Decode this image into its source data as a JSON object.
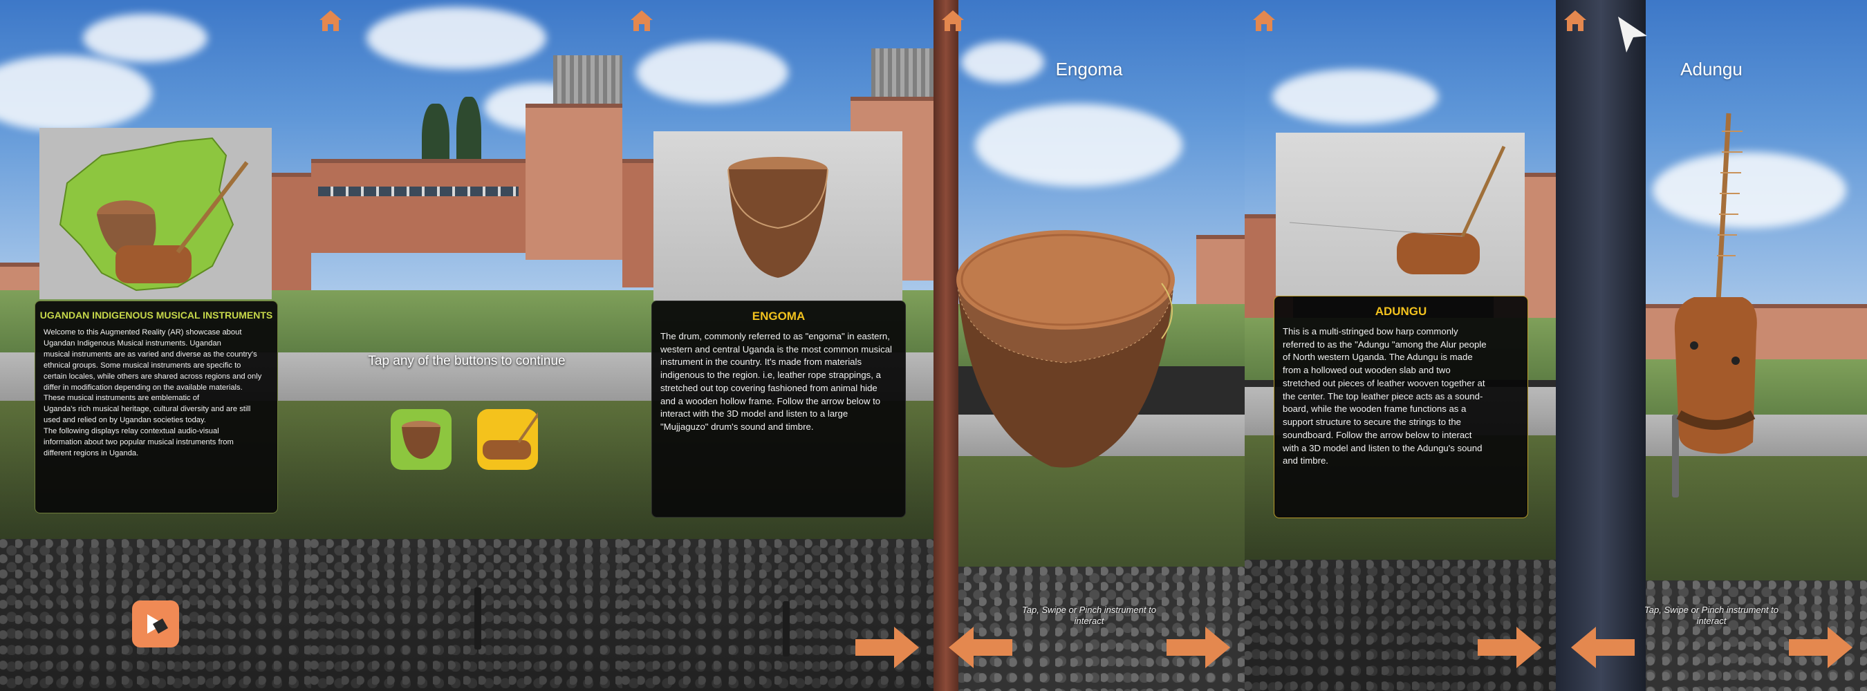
{
  "colors": {
    "accent_orange": "#e4884f",
    "lime": "#8dc63f",
    "gold": "#f4c21c",
    "title_green": "#c7d84a",
    "title_gold": "#f2c21e"
  },
  "screens": [
    {
      "id": "intro",
      "card": {
        "title": "UGANDAN INDIGENOUS  MUSICAL INSTRUMENTS",
        "body": "Welcome to this Augmented Reality (AR) showcase about\nUgandan Indigenous Musical instruments. Ugandan\nmusical instruments are as varied and diverse as the country's\nethnical groups. Some musical instruments are specific to\ncertain locales, while others are shared across regions and only\ndiffer in modification depending on the available materials.\nThese musical instruments are emblematic of\nUganda's rich musical heritage, cultural diversity and are still\nused and relied on by Ugandan societies today.\nThe following displays relay contextual audio-visual\ninformation about two popular musical instruments from\n different regions in Uganda."
      },
      "icons": [
        "uganda-map-icon",
        "play-next-icon"
      ]
    },
    {
      "id": "select",
      "prompt": "Tap any of the buttons to continue",
      "buttons": [
        {
          "name": "engoma-select-button",
          "color": "#8dc63f"
        },
        {
          "name": "adungu-select-button",
          "color": "#f4c21c"
        }
      ]
    },
    {
      "id": "engoma-info",
      "card": {
        "title": "ENGOMA",
        "body": "The drum, commonly referred to as \"engoma\" in eastern,\nwestern and central Uganda is the most common musical\ninstrument in the country. It's made from materials\n indigenous to the region. i.e,  leather rope strappings, a\nstretched out top covering fashioned from animal hide\nand a wooden hollow frame. Follow the arrow below to\ninteract with the 3D model and listen to a large\n\"Mujjaguzo\" drum's sound and timbre."
      }
    },
    {
      "id": "engoma-3d",
      "title": "Engoma",
      "hint": "Tap, Swipe or Pinch\ninstrument to interact"
    },
    {
      "id": "adungu-info",
      "card": {
        "title": "ADUNGU",
        "body": "This is a multi-stringed bow harp commonly\nreferred to as the  \"Adungu \"among the Alur people\nof North western Uganda. The Adungu is made\nfrom a hollowed out wooden slab and two\nstretched out pieces of leather wooven together at\nthe center. The top leather piece acts as a sound-\nboard, while the wooden frame functions as a\nsupport structure to secure the strings to the\nsoundboard. Follow the arrow below to interact\nwith a 3D model and listen to the Adungu's sound\nand timbre."
      }
    },
    {
      "id": "adungu-3d",
      "title": "Adungu",
      "hint": "Tap, Swipe or Pinch\ninstrument to interact"
    }
  ]
}
